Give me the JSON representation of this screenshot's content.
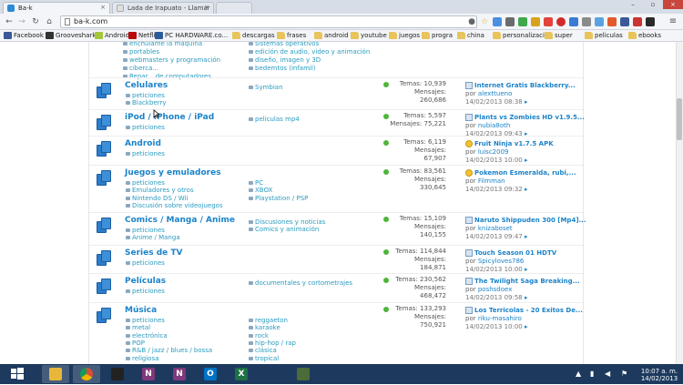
{
  "browser": {
    "tabs": [
      {
        "title": "Ba-k",
        "active": true
      },
      {
        "title": "Lada de Irapuato - Llamar",
        "active": false
      },
      {
        "title": "",
        "active": false
      }
    ],
    "url": "ba-k.com",
    "window_controls": [
      "–",
      "▫",
      "×"
    ]
  },
  "bookmarks": [
    {
      "label": "Facebook",
      "icon": "facebook-icon",
      "color": "#3b5998"
    },
    {
      "label": "Grooveshark",
      "icon": "grooveshark-icon",
      "color": "#333333"
    },
    {
      "label": "Android",
      "icon": "android-icon",
      "color": "#a4c639"
    },
    {
      "label": "Netflix",
      "icon": "netflix-icon",
      "color": "#b9090b"
    },
    {
      "label": "PC HARDWARE.co...",
      "icon": "pc-hardware-icon",
      "color": "#2b5a9c"
    },
    {
      "label": "descargas",
      "icon": "folder-icon"
    },
    {
      "label": "frases",
      "icon": "folder-icon"
    },
    {
      "label": "android",
      "icon": "folder-icon"
    },
    {
      "label": "youtube",
      "icon": "folder-icon"
    },
    {
      "label": "juegos",
      "icon": "folder-icon"
    },
    {
      "label": "progra",
      "icon": "folder-icon"
    },
    {
      "label": "china",
      "icon": "folder-icon"
    },
    {
      "label": "personalizacion",
      "icon": "folder-icon"
    },
    {
      "label": "super",
      "icon": "folder-icon"
    },
    {
      "label": "peliculas",
      "icon": "folder-icon"
    },
    {
      "label": "ebooks",
      "icon": "folder-icon"
    }
  ],
  "top_subforums": {
    "left": [
      "enchulame la maquina",
      "portables",
      "webmasters y programación",
      "ciberca...",
      "Repar... de computadores"
    ],
    "right": [
      "sistemas operativos",
      "edición de audio, video y animación",
      "diseño, imagen y 3D",
      "bedemtos (infamil)"
    ]
  },
  "forums": [
    {
      "title": "Celulares",
      "left": [
        "peticiones",
        "Blackberry"
      ],
      "right": [
        "Symbian"
      ],
      "temas": "10,939",
      "mensajes": "260,686",
      "last": {
        "title": "Internet Gratis Blackberry...",
        "by": "alexttueno",
        "date": "14/02/2013 08:38",
        "icon": "doc"
      }
    },
    {
      "title": "iPod / iPhone / iPad",
      "left": [
        "peticiones"
      ],
      "right": [
        "peliculas mp4"
      ],
      "temas": "5,597",
      "mensajes": "75,221",
      "last": {
        "title": "Plants vs Zombies HD v1.9.5...",
        "by": "nubia8oth",
        "date": "14/02/2013 09:43",
        "icon": "doc"
      }
    },
    {
      "title": "Android",
      "left": [
        "peticiones"
      ],
      "right": [],
      "temas": "6,119",
      "mensajes": "67,907",
      "last": {
        "title": "Fruit Ninja v1.7.5 APK",
        "by": "luisc2009",
        "date": "14/02/2013 10:00",
        "icon": "star"
      }
    },
    {
      "title": "Juegos y emuladores",
      "left": [
        "peticiones",
        "Emuladores y otros",
        "Nintendo DS / Wii",
        "Discusión sobre videojuegos"
      ],
      "right": [
        "PC",
        "XBOX",
        "Playstation / PSP"
      ],
      "temas": "83,561",
      "mensajes": "330,645",
      "last": {
        "title": "Pokemon Esmeralda, rubi,...",
        "by": "Filmman",
        "date": "14/02/2013 09:32",
        "icon": "star"
      }
    },
    {
      "title": "Comics / Manga / Anime",
      "left": [
        "peticiones",
        "Anime / Manga"
      ],
      "right": [
        "Discusiones y noticias",
        "Comics y animación"
      ],
      "temas": "15,109",
      "mensajes": "140,155",
      "last": {
        "title": "Naruto Shippuden 300 [Mp4]...",
        "by": "knizaboset",
        "date": "14/02/2013 09:47",
        "icon": "doc"
      }
    },
    {
      "title": "Series de TV",
      "left": [
        "peticiones"
      ],
      "right": [],
      "temas": "114,844",
      "mensajes": "184,871",
      "last": {
        "title": "Touch Season 01 HDTV",
        "by": "Spicyloves786",
        "date": "14/02/2013 10:00",
        "icon": "doc"
      }
    },
    {
      "title": "Películas",
      "left": [
        "peticiones"
      ],
      "right": [
        "documentales y cortometrajes"
      ],
      "temas": "230,562",
      "mensajes": "468,472",
      "last": {
        "title": "The Twilight Saga Breaking...",
        "by": "poshsdoex",
        "date": "14/02/2013 09:58",
        "icon": "doc"
      }
    },
    {
      "title": "Música",
      "left": [
        "peticiones",
        "metal",
        "electrónica",
        "POP",
        "R&B / jazz / blues / bossa",
        "religiosa"
      ],
      "right": [
        "reggaeton",
        "karaoke",
        "rock",
        "hip-hop / rap",
        "clásica",
        "tropical"
      ],
      "temas": "133,293",
      "mensajes": "750,921",
      "last": {
        "title": "Los Terricolas - 20 Exitos De...",
        "by": "riku-masahiro",
        "date": "14/02/2013 10:00",
        "icon": "doc"
      }
    }
  ],
  "labels": {
    "temas": "Temas:",
    "mensajes": "Mensajes:",
    "por": "por"
  },
  "taskbar": {
    "apps": [
      {
        "name": "file-explorer-icon",
        "color": "#e8b73a"
      },
      {
        "name": "chrome-icon",
        "color": "#dd4b39"
      },
      {
        "name": "cursor-app-icon",
        "color": "#222222"
      },
      {
        "name": "onenote-icon",
        "color": "#80397b",
        "glyph": "N"
      },
      {
        "name": "onenote-icon-2",
        "color": "#80397b",
        "glyph": "N"
      },
      {
        "name": "outlook-icon",
        "color": "#0072c6",
        "glyph": "O"
      },
      {
        "name": "excel-icon",
        "color": "#1e7145",
        "glyph": "X"
      },
      {
        "name": "presentation-icon",
        "color": "#4a6b3a"
      }
    ],
    "time": "10:07 a. m.",
    "date": "14/02/2013"
  }
}
